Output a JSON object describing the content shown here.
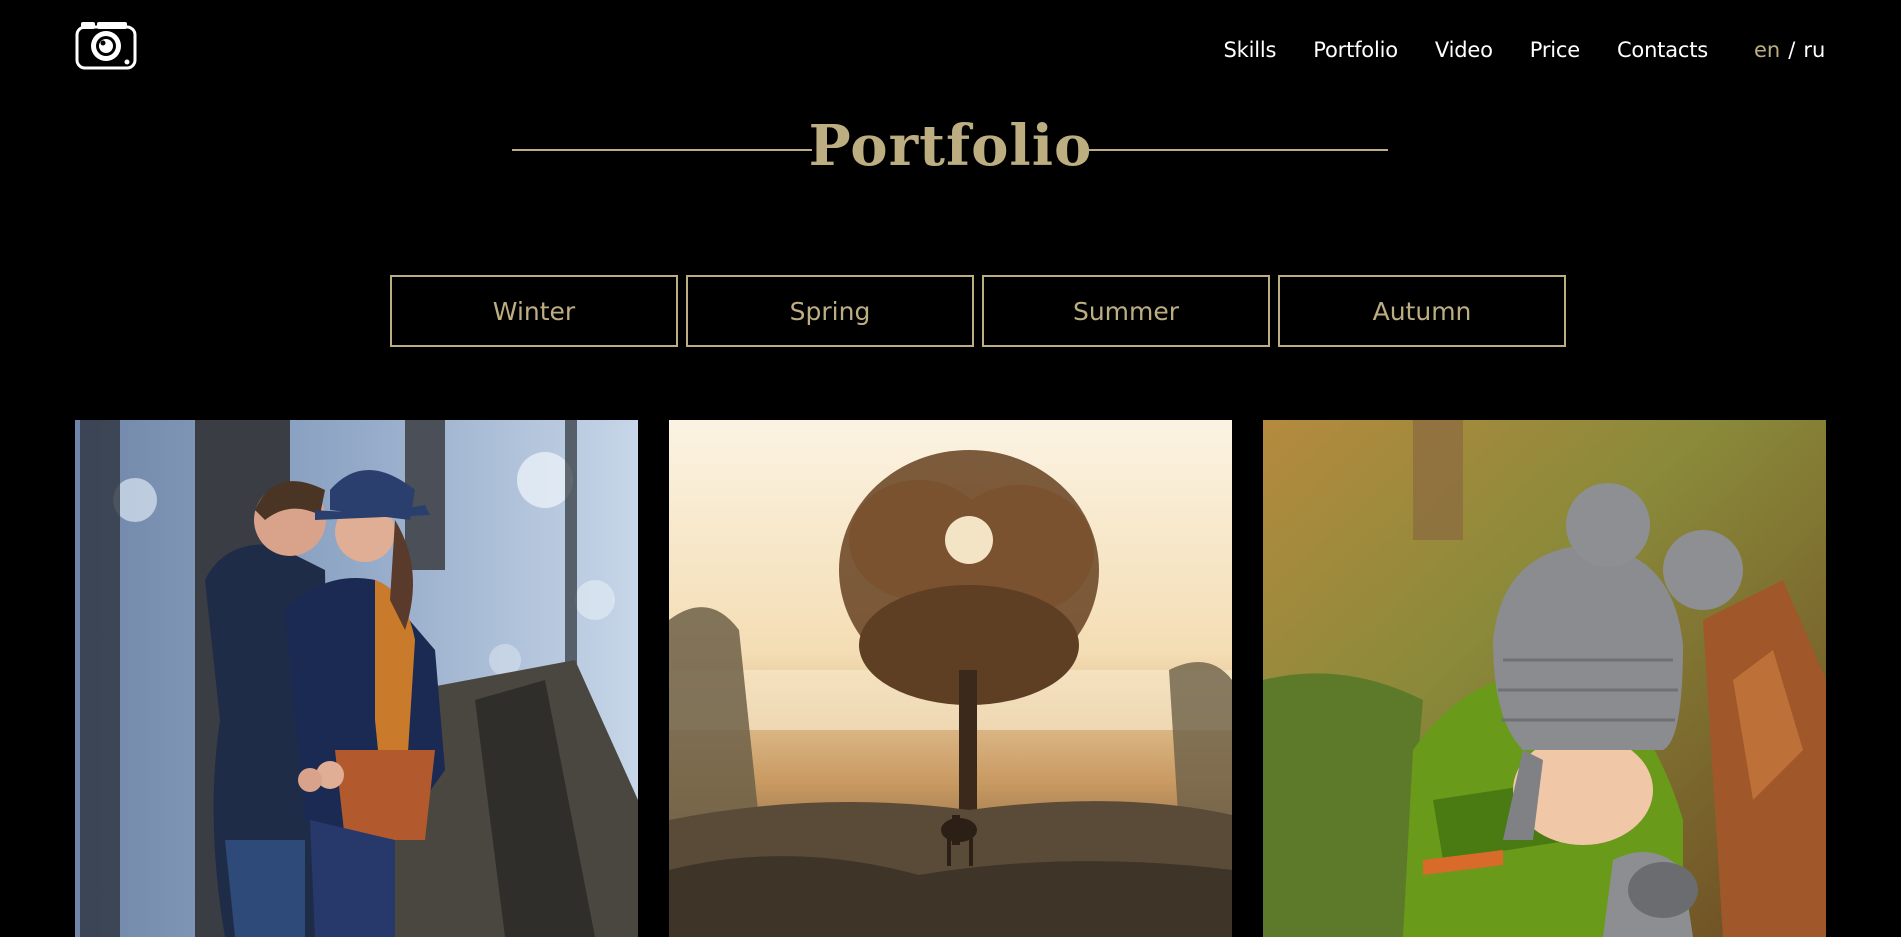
{
  "header": {
    "logo_icon": "camera-icon",
    "nav": [
      {
        "label": "Skills"
      },
      {
        "label": "Portfolio"
      },
      {
        "label": "Video"
      },
      {
        "label": "Price"
      },
      {
        "label": "Contacts"
      }
    ],
    "lang": {
      "en": "en",
      "separator": "/",
      "ru": "ru",
      "active": "en"
    }
  },
  "section": {
    "title": "Portfolio"
  },
  "seasons": [
    {
      "label": "Winter"
    },
    {
      "label": "Spring"
    },
    {
      "label": "Summer"
    },
    {
      "label": "Autumn"
    }
  ],
  "colors": {
    "background": "#000000",
    "accent": "#bdae82",
    "text": "#ffffff"
  },
  "gallery": [
    {
      "subject": "couple-kissing-photo"
    },
    {
      "subject": "tree-sunrise-horse-photo"
    },
    {
      "subject": "child-in-knit-hat-photo"
    }
  ]
}
